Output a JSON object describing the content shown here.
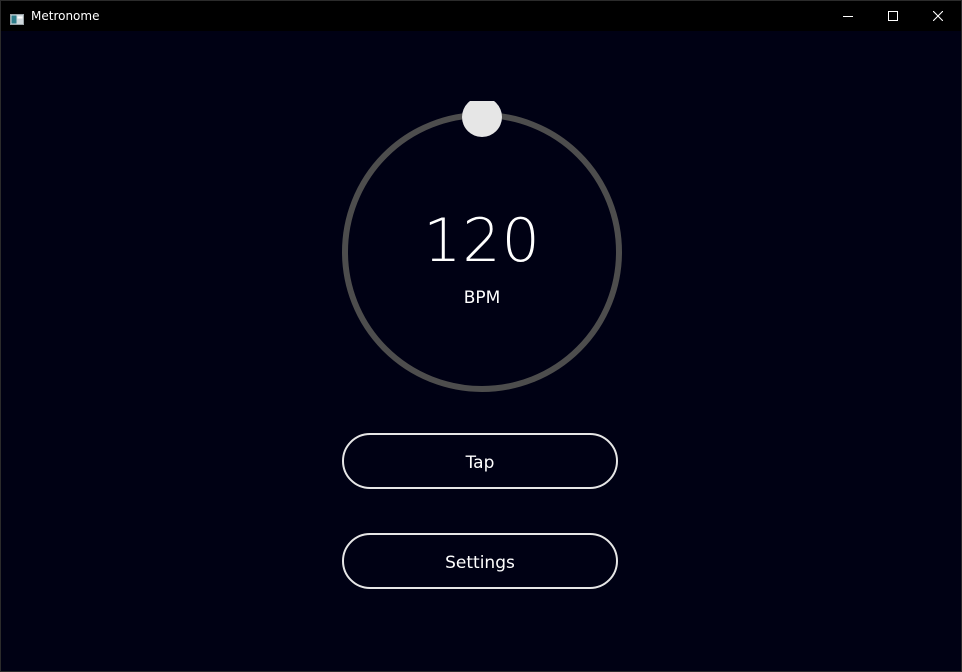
{
  "window": {
    "title": "Metronome",
    "icon": "app-window-icon",
    "controls": {
      "minimize_icon": "minimize-icon",
      "maximize_icon": "maximize-icon",
      "close_icon": "close-icon"
    }
  },
  "tempo": {
    "value": "120",
    "unit": "BPM"
  },
  "buttons": {
    "tap_label": "Tap",
    "settings_label": "Settings"
  },
  "colors": {
    "background": "#000114",
    "titlebar": "#000000",
    "ring": "#4d4d4d",
    "knob": "#e6e6e6",
    "button_border": "#e6e6e6",
    "text": "#ffffff"
  }
}
